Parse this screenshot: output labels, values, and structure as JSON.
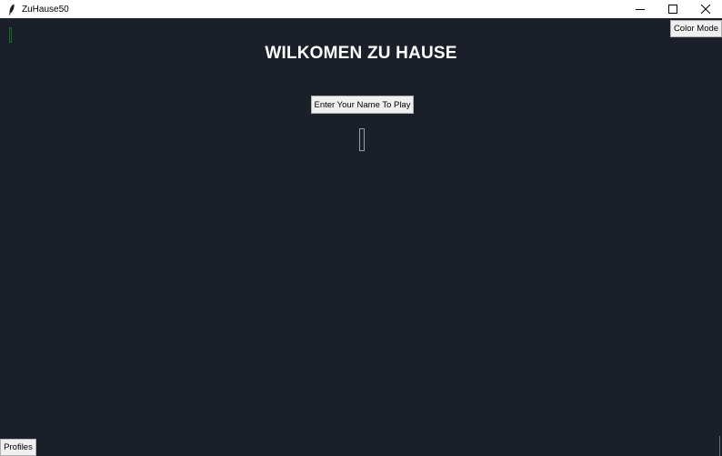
{
  "window": {
    "title": "ZuHause50",
    "icon": "feather-icon",
    "controls": [
      "minimize-icon",
      "maximize-icon",
      "close-icon"
    ]
  },
  "main": {
    "heading": "WILKOMEN ZU HAUSE",
    "name_button_label": "Enter Your Name To Play",
    "name_entry_value": ""
  },
  "toolbar": {
    "color_mode_label": "Color Mode",
    "profiles_label": "Profiles"
  },
  "colors": {
    "background": "#1b1f29",
    "heading_text": "#ffffff",
    "button_face": "#f0f0f0"
  }
}
